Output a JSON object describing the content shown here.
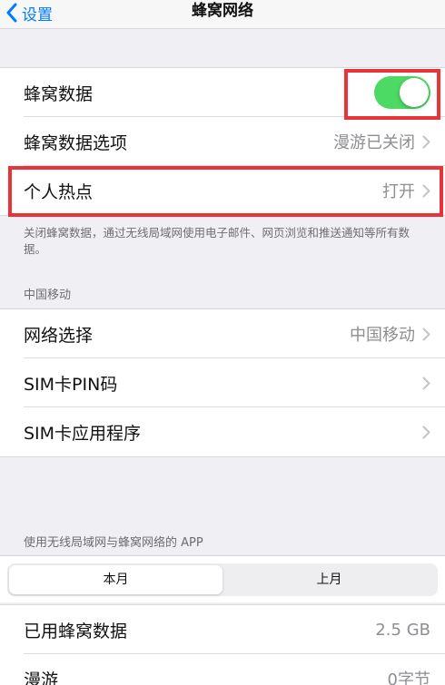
{
  "navbar": {
    "back_label": "设置",
    "title": "蜂窝网络"
  },
  "group1": {
    "cellular_data_label": "蜂窝数据",
    "cellular_data_on": true,
    "options_label": "蜂窝数据选项",
    "options_value": "漫游已关闭",
    "hotspot_label": "个人热点",
    "hotspot_value": "打开"
  },
  "group1_footnote": "关闭蜂窝数据，通过无线局域网使用电子邮件、网页浏览和推送通知等所有数据。",
  "carrier_header": "中国移动",
  "group2": {
    "network_label": "网络选择",
    "network_value": "中国移动",
    "sim_pin_label": "SIM卡PIN码",
    "sim_apps_label": "SIM卡应用程序"
  },
  "apps_header": "使用无线局域网与蜂窝网络的 APP",
  "segments": {
    "current": "本月",
    "previous": "上月"
  },
  "usage": {
    "used_label": "已用蜂窝数据",
    "used_value": "2.5 GB",
    "roaming_label": "漫游",
    "roaming_value": "0字节"
  },
  "colors": {
    "accent": "#007aff",
    "toggle_on": "#4cd964",
    "highlight": "#e8333a"
  }
}
